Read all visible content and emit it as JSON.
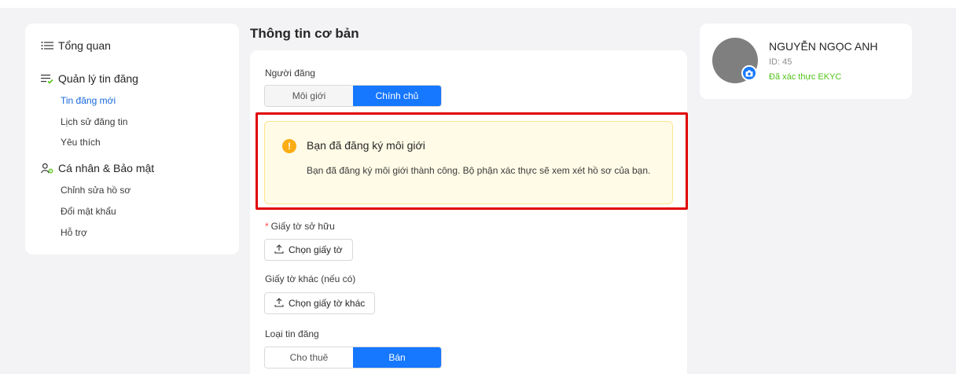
{
  "sidebar": {
    "overview": {
      "label": "Tổng quan",
      "icon": "list-icon"
    },
    "listing_mgmt": {
      "label": "Quản lý tin đăng",
      "icon": "list-check-icon"
    },
    "listing_items": [
      "Tin đăng mới",
      "Lịch sử đăng tin",
      "Yêu thích"
    ],
    "personal": {
      "label": "Cá nhân & Bảo mật",
      "icon": "user-settings-icon"
    },
    "personal_items": [
      "Chỉnh sửa hồ sơ",
      "Đổi mật khẩu",
      "Hỗ trợ"
    ]
  },
  "main": {
    "section_title": "Thông tin cơ bản",
    "poster": {
      "label": "Người đăng",
      "options": [
        "Môi giới",
        "Chính chủ"
      ],
      "selected": "Chính chủ"
    },
    "alert": {
      "title": "Bạn đã đăng ký môi giới",
      "description": "Bạn đã đăng ký môi giới thành công. Bộ phận xác thực sẽ xem xét hồ sơ của bạn.",
      "icon": "warning-icon",
      "color": "#faad14"
    },
    "ownership_doc": {
      "required_mark": "*",
      "label": "Giấy tờ sở hữu",
      "button": "Chọn giấy tờ"
    },
    "other_doc": {
      "label": "Giấy tờ khác (nếu có)",
      "button": "Chọn giấy tờ khác"
    },
    "listing_type": {
      "label": "Loại tin đăng",
      "options": [
        "Cho thuê",
        "Bán"
      ],
      "selected": "Bán"
    }
  },
  "profile": {
    "name": "NGUYỄN NGỌC ANH",
    "id": "ID: 45",
    "verification": "Đã xác thực EKYC"
  },
  "colors": {
    "accent": "#1677ff",
    "verified": "#52c41a",
    "highlight_border": "#e00000"
  }
}
